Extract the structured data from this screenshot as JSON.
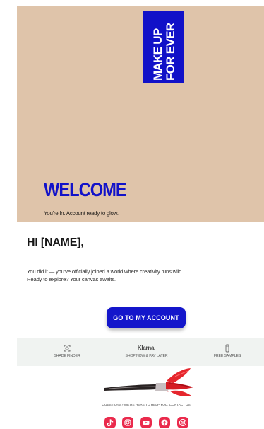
{
  "brand": {
    "logo_lines": [
      "MAKE UP",
      "FOR EVER"
    ],
    "logo_background": "#1111c8",
    "logo_text_color": "#ffffff"
  },
  "hero": {
    "background_color": "#dfc4aa",
    "title": "WELCOME",
    "subtitle": "You're In. Account ready to glow.",
    "title_color": "#1212c9"
  },
  "message": {
    "greeting": "HI [NAME],",
    "body_lines": [
      "You did it — you've officially joined a world where creativity runs wild.",
      "Ready to explore? Your canvas awaits."
    ]
  },
  "cta": {
    "label": "GO TO MY ACCOUNT",
    "background_color": "#1416cb"
  },
  "features": [
    {
      "label": "SHADE FINDER",
      "icon": "shade-finder-icon"
    },
    {
      "logo": "Klarna.",
      "label": "SHOP NOW & PAY LATER",
      "icon": "klarna-logo"
    },
    {
      "label": "FREE SAMPLES",
      "icon": "sample-vial-icon"
    }
  ],
  "support": {
    "text": "QUESTIONS? WE'RE HERE TO HELP YOU. CONTACT US"
  },
  "social": [
    {
      "name": "tiktok-icon",
      "label": "TikTok"
    },
    {
      "name": "instagram-icon",
      "label": "Instagram"
    },
    {
      "name": "youtube-icon",
      "label": "YouTube"
    },
    {
      "name": "facebook-icon",
      "label": "Facebook"
    },
    {
      "name": "email-icon",
      "label": "Email"
    }
  ],
  "colors": {
    "feature_strip": "#f0f3f1",
    "social_accent": "#ea2a4c",
    "brush_accent": "#e5262d"
  }
}
